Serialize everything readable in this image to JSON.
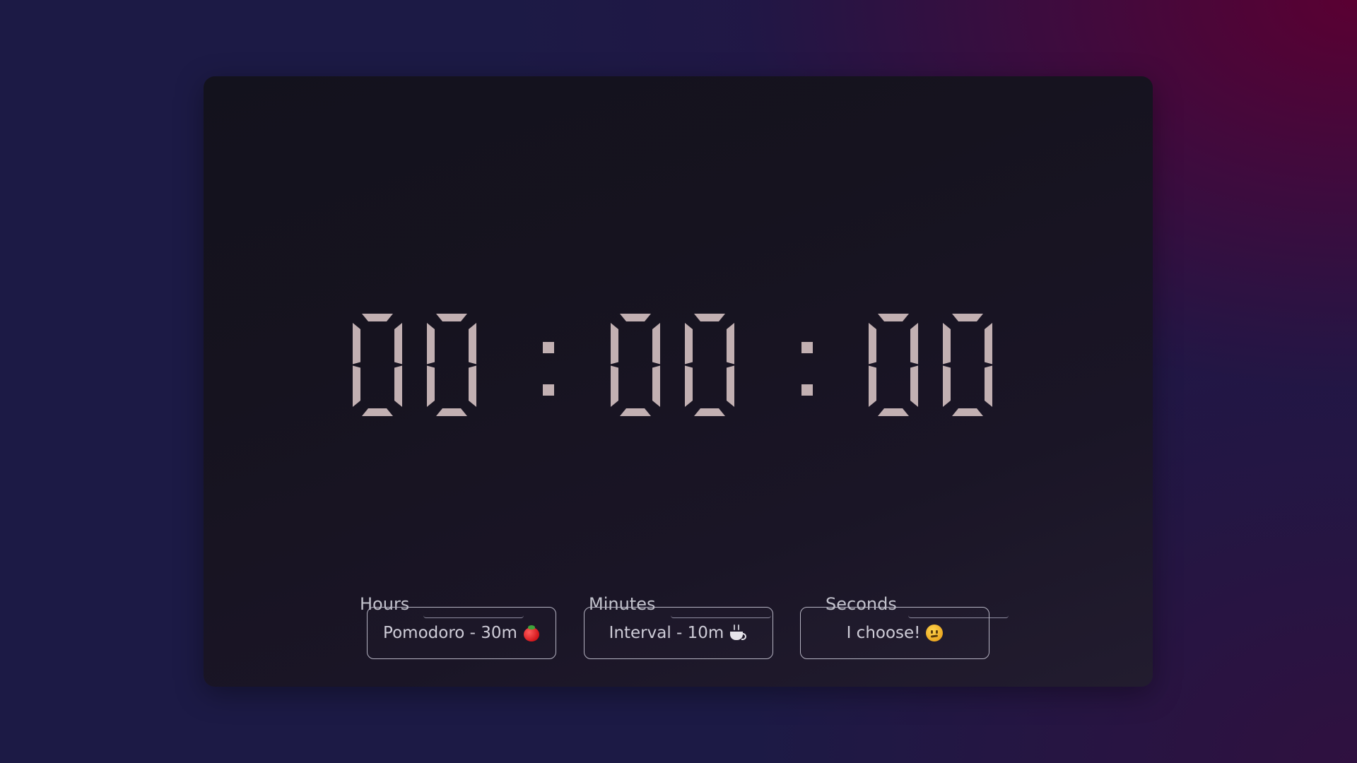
{
  "timer": {
    "hours": "00",
    "minutes": "00",
    "seconds": "00",
    "separator": ":"
  },
  "inputs": [
    {
      "label": "Hours",
      "value": ""
    },
    {
      "label": "Minutes",
      "value": ""
    },
    {
      "label": "Seconds",
      "value": ""
    }
  ],
  "presets": [
    {
      "label": "Pomodoro - 30m",
      "icon": "tomato-icon"
    },
    {
      "label": "Interval - 10m",
      "icon": "coffee-icon"
    },
    {
      "label": "I choose!",
      "icon": "smirk-face-icon"
    }
  ],
  "colors": {
    "digit": "#c2b0b2",
    "card_bg": "#16131f",
    "accent_magenta": "#5a0032"
  }
}
